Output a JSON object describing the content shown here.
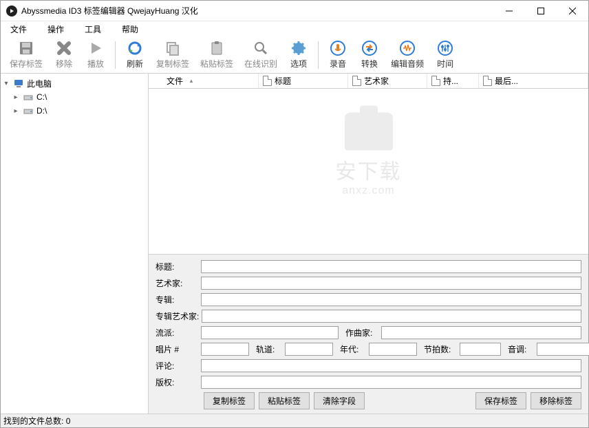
{
  "window": {
    "title": "Abyssmedia ID3 标签编辑器 QwejayHuang 汉化"
  },
  "menu": {
    "file": "文件",
    "operate": "操作",
    "tools": "工具",
    "help": "帮助"
  },
  "toolbar": {
    "save": "保存标签",
    "remove": "移除",
    "play": "播放",
    "refresh": "刷新",
    "copy": "复制标签",
    "paste": "粘贴标签",
    "identify": "在线识别",
    "options": "选项",
    "record": "录音",
    "convert": "转换",
    "editaudio": "编辑音频",
    "time": "时间"
  },
  "tree": {
    "root": "此电脑",
    "drives": [
      "C:\\",
      "D:\\"
    ]
  },
  "columns": {
    "file": "文件",
    "title": "标题",
    "artist": "艺术家",
    "duration": "持...",
    "last": "最后..."
  },
  "watermark": {
    "name": "安下载",
    "url": "anxz.com"
  },
  "editor": {
    "title": "标题:",
    "artist": "艺术家:",
    "album": "专辑:",
    "albumartist": "专辑艺术家:",
    "genre": "流派:",
    "composer": "作曲家:",
    "disc": "唱片 #",
    "track": "轨道:",
    "year": "年代:",
    "bpm": "节拍数:",
    "key": "音调:",
    "comment": "评论:",
    "copyright": "版权:",
    "btn_copy": "复制标签",
    "btn_paste": "粘贴标签",
    "btn_clear": "清除字段",
    "btn_save": "保存标签",
    "btn_remove": "移除标签",
    "values": {
      "title": "",
      "artist": "",
      "album": "",
      "albumartist": "",
      "genre": "",
      "composer": "",
      "disc": "",
      "track": "",
      "year": "",
      "bpm": "",
      "key": "",
      "comment": "",
      "copyright": ""
    }
  },
  "status": {
    "label": "找到的文件总数:",
    "count": "0"
  }
}
